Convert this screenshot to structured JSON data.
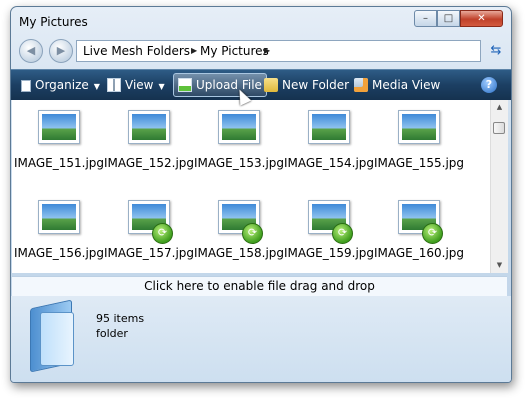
{
  "window": {
    "title": "My Pictures",
    "controls": {
      "minimize": "–",
      "maximize": "□",
      "close": "✕"
    }
  },
  "nav": {
    "back_icon": "back-arrow-icon",
    "forward_icon": "forward-arrow-icon",
    "breadcrumbs": [
      "Live Mesh Folders",
      "My Pictures"
    ],
    "refresh_icon": "refresh-icon"
  },
  "toolbar": {
    "items": [
      {
        "label": "Organize",
        "icon": "organize-icon",
        "dropdown": true
      },
      {
        "label": "View",
        "icon": "view-icon",
        "dropdown": true
      },
      {
        "label": "Upload File",
        "icon": "upload-file-icon",
        "dropdown": false,
        "highlighted": true
      },
      {
        "label": "New Folder",
        "icon": "new-folder-icon",
        "dropdown": false
      },
      {
        "label": "Media View",
        "icon": "media-view-icon",
        "dropdown": false
      }
    ],
    "help_icon": "help-icon"
  },
  "files": [
    {
      "name": "IMAGE_151.jpg",
      "synced": false
    },
    {
      "name": "IMAGE_152.jpg",
      "synced": false
    },
    {
      "name": "IMAGE_153.jpg",
      "synced": false
    },
    {
      "name": "IMAGE_154.jpg",
      "synced": false
    },
    {
      "name": "IMAGE_155.jpg",
      "synced": false
    },
    {
      "name": "IMAGE_156.jpg",
      "synced": false
    },
    {
      "name": "IMAGE_157.jpg",
      "synced": true
    },
    {
      "name": "IMAGE_158.jpg",
      "synced": true
    },
    {
      "name": "IMAGE_159.jpg",
      "synced": true
    },
    {
      "name": "IMAGE_160.jpg",
      "synced": true
    }
  ],
  "dragbar": {
    "text": "Click here to enable file drag and drop"
  },
  "details": {
    "count": "95 items",
    "kind": "folder"
  },
  "colors": {
    "toolbar": "#1c3f63",
    "accent": "#2a6fc5",
    "sync": "#3f9e1e"
  }
}
